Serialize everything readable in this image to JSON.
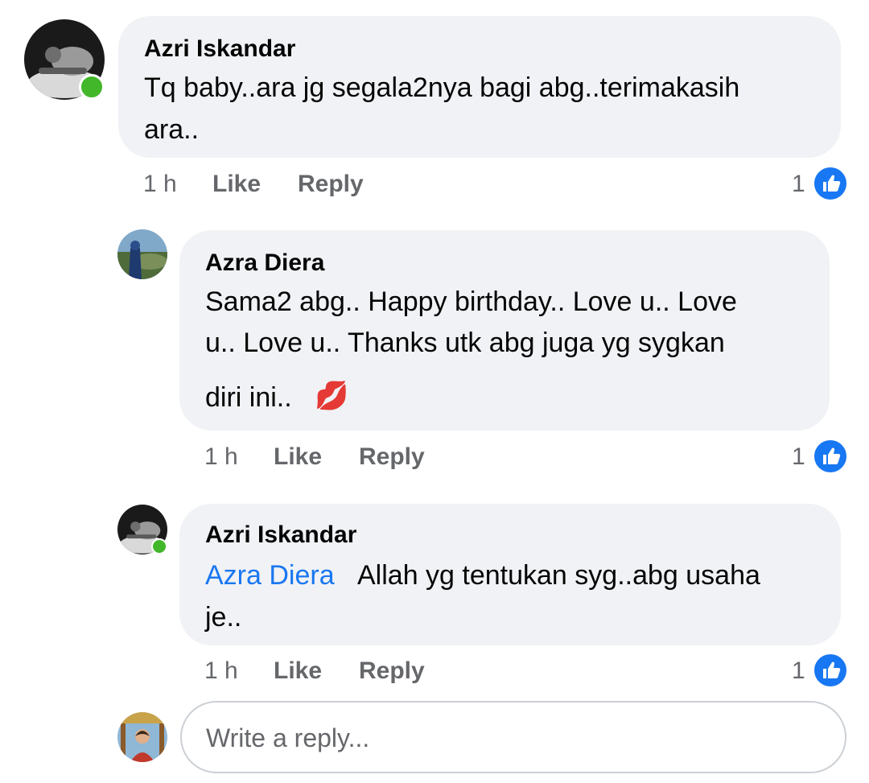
{
  "comments": [
    {
      "author": "Azri Iskandar",
      "text_lines": [
        "Tq baby..ara jg segala2nya bagi abg..terimakasih",
        "ara.."
      ],
      "time": "1 h",
      "like_label": "Like",
      "reply_label": "Reply",
      "reaction_count": "1",
      "online": true
    },
    {
      "author": "Azra Diera",
      "text_lines": [
        "Sama2 abg.. Happy birthday.. Love u.. Love",
        "u.. Love u.. Thanks utk abg juga yg sygkan",
        "diri ini.."
      ],
      "emoji": "💋",
      "time": "1 h",
      "like_label": "Like",
      "reply_label": "Reply",
      "reaction_count": "1",
      "online": false
    },
    {
      "author": "Azri Iskandar",
      "mention": "Azra Diera",
      "text_lines": [
        "Allah yg tentukan syg..abg usaha",
        "je.."
      ],
      "time": "1 h",
      "like_label": "Like",
      "reply_label": "Reply",
      "reaction_count": "1",
      "online": true
    }
  ],
  "reply_input": {
    "placeholder": "Write a reply..."
  },
  "colors": {
    "bubble": "#f0f2f5",
    "mention": "#1877f2",
    "online": "#42b72a",
    "like_badge": "#1877f2",
    "meta": "#65676b"
  },
  "icons": {
    "reaction": "thumbs-up-icon",
    "emoji": "kiss-mark-icon"
  }
}
